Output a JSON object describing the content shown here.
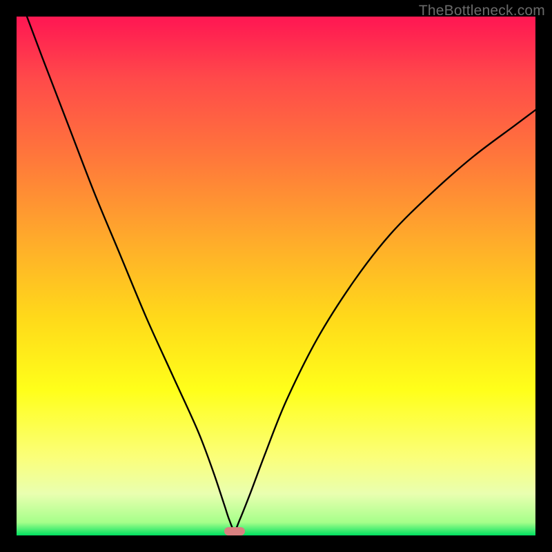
{
  "watermark": {
    "text": "TheBottleneck.com"
  },
  "chart_data": {
    "type": "line",
    "title": "",
    "xlabel": "",
    "ylabel": "",
    "xlim": [
      0,
      100
    ],
    "ylim": [
      0,
      100
    ],
    "grid": false,
    "legend": false,
    "series": [
      {
        "name": "bottleneck-curve",
        "x": [
          2,
          5,
          10,
          15,
          20,
          25,
          30,
          35,
          38,
          40,
          41,
          42,
          43,
          45,
          48,
          52,
          58,
          65,
          72,
          80,
          88,
          96,
          100
        ],
        "y": [
          100,
          92,
          79,
          66,
          54,
          42,
          31,
          20,
          12,
          6,
          3,
          1,
          3,
          8,
          16,
          26,
          38,
          49,
          58,
          66,
          73,
          79,
          82
        ]
      }
    ],
    "marker": {
      "x": 42,
      "y": 0,
      "width_pct": 4.0,
      "height_pct": 1.6,
      "color": "#d98080"
    },
    "background_gradient": {
      "type": "vertical",
      "stops": [
        {
          "pos": 0.0,
          "color": "#ff1a52"
        },
        {
          "pos": 0.28,
          "color": "#ff7a3a"
        },
        {
          "pos": 0.58,
          "color": "#ffd91a"
        },
        {
          "pos": 0.85,
          "color": "#fbff7a"
        },
        {
          "pos": 1.0,
          "color": "#00e060"
        }
      ]
    }
  }
}
